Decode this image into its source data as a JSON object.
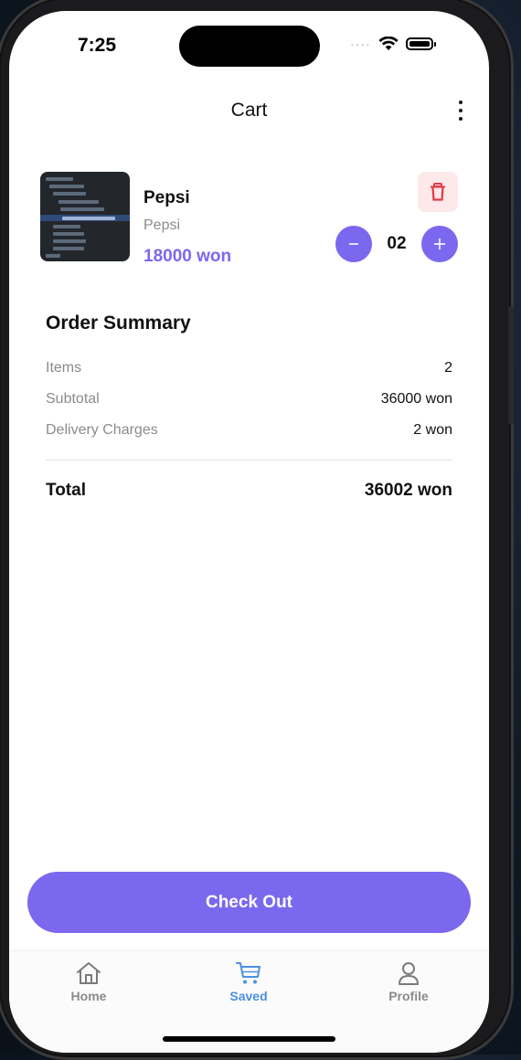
{
  "status_bar": {
    "time": "7:25",
    "signal": "····"
  },
  "header": {
    "title": "Cart"
  },
  "cart": {
    "items": [
      {
        "name": "Pepsi",
        "subtitle": "Pepsi",
        "price": "18000 won",
        "quantity": "02"
      }
    ]
  },
  "summary": {
    "title": "Order Summary",
    "rows": [
      {
        "label": "Items",
        "value": "2"
      },
      {
        "label": "Subtotal",
        "value": "36000 won"
      },
      {
        "label": "Delivery Charges",
        "value": "2 won"
      }
    ],
    "total_label": "Total",
    "total_value": "36002 won"
  },
  "checkout": {
    "label": "Check Out"
  },
  "bottom_nav": {
    "items": [
      {
        "label": "Home",
        "icon": "home-icon",
        "active": false
      },
      {
        "label": "Saved",
        "icon": "cart-icon",
        "active": true
      },
      {
        "label": "Profile",
        "icon": "person-icon",
        "active": false
      }
    ]
  },
  "colors": {
    "accent": "#7b68ee",
    "nav_active": "#4a90e2",
    "nav_inactive": "#8a8a8a",
    "delete_bg": "#fde8ea",
    "delete_icon": "#e53945"
  }
}
